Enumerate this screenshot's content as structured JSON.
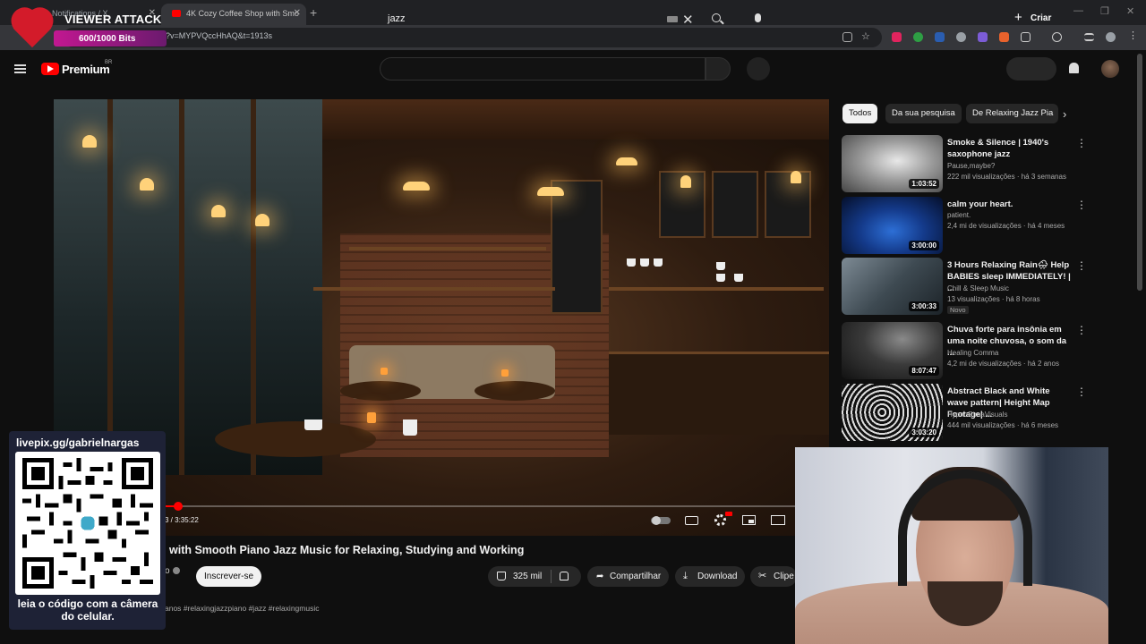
{
  "browser": {
    "tabs": [
      {
        "title": "Notifications / X"
      },
      {
        "title": "4K Cozy Coffee Shop with Smo"
      }
    ],
    "url": "?v=MYPVQccHhAQ&t=1913s"
  },
  "header": {
    "brand": "Premium",
    "region": "BR",
    "search_value": "jazz",
    "create_label": "Criar"
  },
  "player": {
    "time": "3 / 3:35:22",
    "progress_fraction": 0.16
  },
  "video": {
    "title": "with Smooth Piano Jazz Music for Relaxing, Studying and Working",
    "channel_suffix": "o",
    "subscribe_label": "Inscrever-se",
    "likes": "325 mil",
    "share_label": "Compartilhar",
    "download_label": "Download",
    "clip_label": "Clipe",
    "desc_age": "anos",
    "desc_tags": "#relaxingjazzpiano #jazz #relaxingmusic"
  },
  "sidebar": {
    "chips": [
      "Todos",
      "Da sua pesquisa",
      "De Relaxing Jazz Pia"
    ],
    "recs": [
      {
        "title": "Smoke & Silence   |   1940's saxophone jazz",
        "channel": "Pause,maybe?",
        "meta": "222 mil visualizações · há 3 semanas",
        "duration": "1:03:52",
        "badge": ""
      },
      {
        "title": "calm your heart.",
        "channel": "patient.",
        "meta": "2,4 mi de visualizações · há 4 meses",
        "duration": "3:00:00",
        "badge": ""
      },
      {
        "title": "3 Hours Relaxing Rain🌧 Help BABIES sleep IMMEDIATELY! | ...",
        "channel": "Chill & Sleep Music",
        "meta": "13 visualizações · há 8 horas",
        "duration": "3:00:33",
        "badge": "Novo"
      },
      {
        "title": "Chuva forte para insônia em uma noite chuvosa, o som da ...",
        "channel": "Healing Comma",
        "meta": "4,2 mi de visualizações · há 2 anos",
        "duration": "8:07:47",
        "badge": ""
      },
      {
        "title": "Abstract Black and White wave pattern| Height Map Footage| ...",
        "channel": "HypnoRimaVisuals",
        "meta": "444 mil visualizações · há 6 meses",
        "duration": "3:03:20",
        "badge": ""
      }
    ]
  },
  "overlay": {
    "alert_title": "VIEWER ATTACK",
    "alert_bits": "600/1000 Bits",
    "qr_url": "livepix.gg/gabrielnargas",
    "qr_caption": "leia o código com a câmera do celular."
  }
}
